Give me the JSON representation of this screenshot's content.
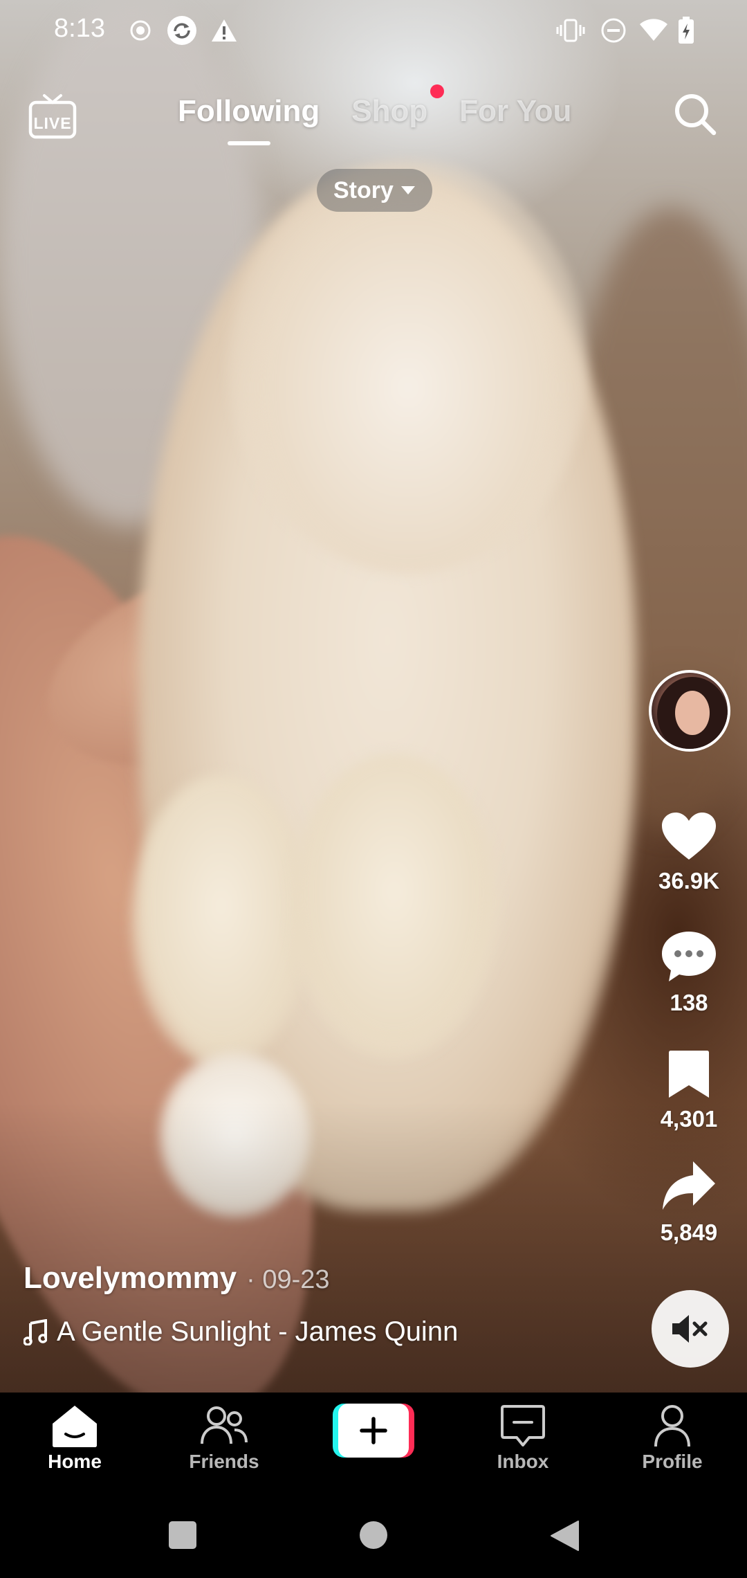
{
  "status_bar": {
    "time": "8:13",
    "left_icons": [
      "record-icon",
      "sync-icon",
      "warning-icon"
    ],
    "right_icons": [
      "vibrate-icon",
      "do-not-disturb-icon",
      "wifi-icon",
      "battery-charging-icon"
    ]
  },
  "top_nav": {
    "live_label": "LIVE",
    "tabs": [
      {
        "label": "Following",
        "active": true
      },
      {
        "label": "Shop",
        "active": false,
        "has_dot": true
      },
      {
        "label": "For You",
        "active": false
      }
    ],
    "story_label": "Story"
  },
  "rail": {
    "likes": "36.9K",
    "comments": "138",
    "saves": "4,301",
    "shares": "5,849"
  },
  "caption": {
    "author": "Lovelymommy",
    "date": "· 09-23",
    "music": "A Gentle Sunlight - James Quinn"
  },
  "bottom_nav": {
    "items": [
      {
        "label": "Home",
        "active": true
      },
      {
        "label": "Friends",
        "active": false
      },
      {
        "label": "Inbox",
        "active": false
      },
      {
        "label": "Profile",
        "active": false
      }
    ]
  },
  "colors": {
    "accent_red": "#fe2c55",
    "accent_cyan": "#25f4ee"
  }
}
